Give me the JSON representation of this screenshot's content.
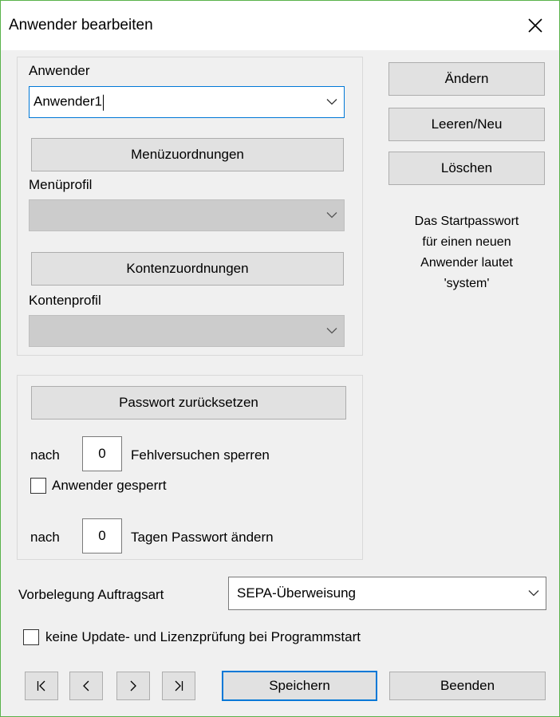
{
  "window": {
    "title": "Anwender bearbeiten"
  },
  "user": {
    "label": "Anwender",
    "value": "Anwender1",
    "menu_button": "Menüzuordnungen",
    "menu_profile_label": "Menüprofil",
    "menu_profile_value": "",
    "account_button": "Kontenzuordnungen",
    "account_profile_label": "Kontenprofil",
    "account_profile_value": ""
  },
  "actions": {
    "change": "Ändern",
    "clear_new": "Leeren/Neu",
    "delete": "Löschen"
  },
  "info": [
    "Das Startpasswort",
    "für einen neuen",
    "Anwender lautet",
    "'system'"
  ],
  "password": {
    "reset_button": "Passwort zurücksetzen",
    "lock_prefix": "nach",
    "lock_value": "0",
    "lock_suffix": "Fehlversuchen sperren",
    "locked_label": "Anwender gesperrt",
    "locked_checked": false,
    "change_prefix": "nach",
    "change_value": "0",
    "change_suffix": "Tagen Passwort ändern"
  },
  "order": {
    "label": "Vorbelegung Auftragsart",
    "value": "SEPA-Überweisung"
  },
  "update_check": {
    "label": "keine Update- und Lizenzprüfung bei Programmstart",
    "checked": false
  },
  "nav": {
    "first": "|<",
    "prev": "<",
    "next": ">",
    "last": ">|",
    "save": "Speichern",
    "exit": "Beenden"
  },
  "icons": {
    "close": "close-icon",
    "dropdown": "chevron-down-icon"
  },
  "colors": {
    "focus_border": "#0078d7",
    "window_border": "#59b24a",
    "button_face": "#e1e1e1"
  }
}
